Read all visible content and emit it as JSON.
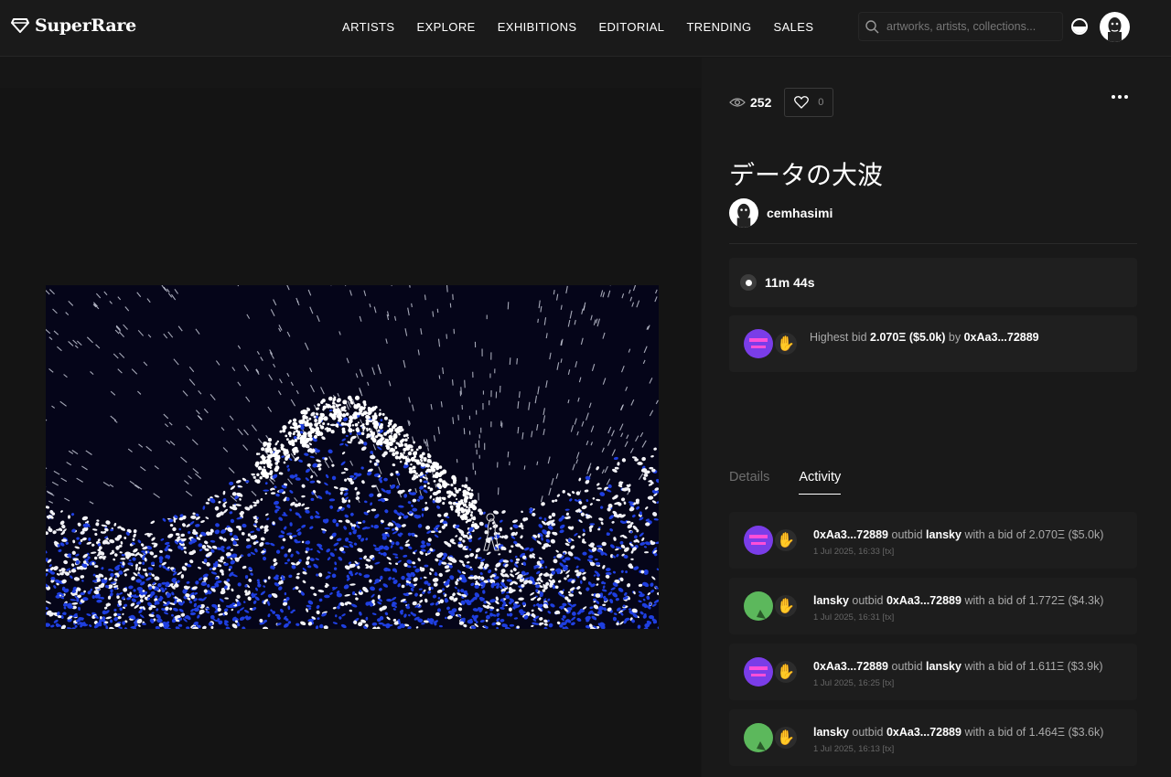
{
  "header": {
    "logo_text": "SuperRare",
    "nav": [
      "ARTISTS",
      "EXPLORE",
      "EXHIBITIONS",
      "EDITORIAL",
      "TRENDING",
      "SALES"
    ],
    "search_placeholder": "artworks, artists, collections..."
  },
  "artwork": {
    "title": "データの大波",
    "artist": "cemhasimi",
    "views": "252",
    "likes": "0"
  },
  "auction": {
    "timer": "11m 44s",
    "bid_prefix": "Highest bid",
    "bid_amount": "2.070Ξ ($5.0k)",
    "bid_by": "by",
    "bidder": "0xAa3...72889"
  },
  "tabs": [
    "Details",
    "Activity"
  ],
  "activity": [
    {
      "actor": "0xAa3...72889",
      "verb": "outbid",
      "target": "lansky",
      "amount": "with a bid of 2.070Ξ ($5.0k)",
      "time": "1 Jul 2025, 16:33",
      "tx": "[tx]",
      "avatar": "purple"
    },
    {
      "actor": "lansky",
      "verb": "outbid",
      "target": "0xAa3...72889",
      "amount": "with a bid of 1.772Ξ ($4.3k)",
      "time": "1 Jul 2025, 16:31",
      "tx": "[tx]",
      "avatar": "green"
    },
    {
      "actor": "0xAa3...72889",
      "verb": "outbid",
      "target": "lansky",
      "amount": "with a bid of 1.611Ξ ($3.9k)",
      "time": "1 Jul 2025, 16:25",
      "tx": "[tx]",
      "avatar": "purple"
    },
    {
      "actor": "lansky",
      "verb": "outbid",
      "target": "0xAa3...72889",
      "amount": "with a bid of 1.464Ξ ($3.6k)",
      "time": "1 Jul 2025, 16:13",
      "tx": "[tx]",
      "avatar": "green"
    }
  ],
  "colors": {
    "accent_purple": "#7a3de8",
    "accent_green": "#5cb85c",
    "wave_blue": "#1f3fe0"
  }
}
